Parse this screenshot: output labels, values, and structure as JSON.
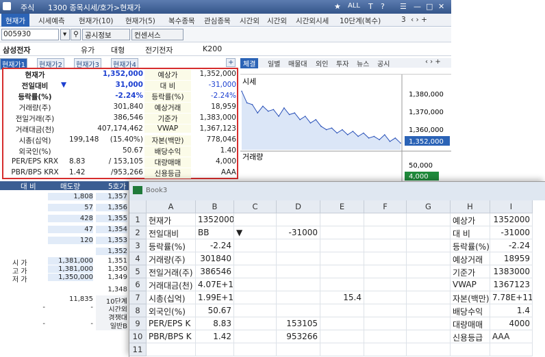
{
  "window": {
    "menu_label": "주식",
    "title": "1300 종목시세/호가>현재가"
  },
  "title_buttons": [
    "★",
    "ALL",
    "T",
    "?",
    "☰",
    "—",
    "□",
    "✕"
  ],
  "menu_tabs": [
    "현재가",
    "시세예측",
    "현재가(10)",
    "현재가(5)",
    "복수종목",
    "관심종목",
    "시간외",
    "시간외",
    "시간외시세",
    "10단계(복수)",
    "3"
  ],
  "search": {
    "code": "005930",
    "btn_info": "공시정보",
    "btn_consensus": "컨센서스"
  },
  "stock": {
    "name": "삼성전자",
    "market": "유가",
    "size": "대형",
    "sector": "전기전자",
    "index": "K200"
  },
  "sub_tabs": [
    "현재가1",
    "현재가2",
    "현재가3",
    "현재가4"
  ],
  "quote_rows": [
    {
      "l1": "현재가",
      "v1": "1,352,000",
      "l2": "예상가",
      "v2": "1,352,000"
    },
    {
      "l1": "전일대비",
      "sym": "▼",
      "v1": "31,000",
      "l2": "대 비",
      "v2": "-31,000"
    },
    {
      "l1": "등락률(%)",
      "v1": "-2.24%",
      "l2": "등락률(%)",
      "v2": "-2.24%"
    },
    {
      "l1": "거래량(주)",
      "v1": "301,840",
      "l2": "예상거래",
      "v2": "18,959"
    },
    {
      "l1": "전일거래(주)",
      "v1": "386,546",
      "l2": "기준가",
      "v2": "1,383,000"
    },
    {
      "l1": "거래대금(천)",
      "v1": "407,174,462",
      "l2": "VWAP",
      "v2": "1,367,123"
    },
    {
      "l1": "시총(십억)",
      "v0": "199,148",
      "v1": "(15.40%)",
      "l2": "자본(백만)",
      "v2": "778,046"
    },
    {
      "l1": "외국인(%)",
      "v1": "50.67",
      "l2": "배당수익",
      "v2": "1.40"
    },
    {
      "l1": "PER/EPS KRX",
      "v0": "8.83",
      "v1": "/ 153,105",
      "l2": "대량매매",
      "v2": "4,000"
    },
    {
      "l1": "PBR/BPS KRX",
      "v0": "1.42",
      "v1": "/953,266",
      "l2": "신용등급",
      "v2": "AAA"
    }
  ],
  "right_tabs": [
    "체결",
    "일별",
    "매물대",
    "외인",
    "투자",
    "뉴스",
    "공시"
  ],
  "chart": {
    "label_price": "시세",
    "label_volume": "거래량",
    "price_ticks": [
      "1,380,000",
      "1,370,000",
      "1,360,000"
    ],
    "current": "1,352,000",
    "vol_tick": "50,000",
    "vol_current": "4,000"
  },
  "chart_data": {
    "type": "line",
    "series": [
      {
        "values": [
          1383000,
          1376000,
          1375000,
          1370000,
          1374000,
          1371000,
          1372000,
          1368000,
          1373000,
          1369000,
          1370000,
          1366000,
          1368000,
          1364000,
          1366000,
          1362000,
          1360000,
          1361000,
          1358000,
          1360000,
          1357000,
          1359000,
          1356000,
          1358000,
          1355000,
          1356000,
          1354000,
          1357000,
          1353000,
          1355000,
          1352000
        ]
      }
    ],
    "ylim": [
      1348000,
      1388000
    ]
  },
  "left_grid": {
    "headers": [
      "대 비",
      "매도량",
      "5호가"
    ],
    "sell": [
      [
        "",
        "1,808",
        "1,357"
      ],
      [
        "",
        "57",
        "1,356"
      ],
      [
        "",
        "428",
        "1,355"
      ],
      [
        "",
        "47",
        "1,354"
      ],
      [
        "",
        "120",
        "1,353"
      ]
    ],
    "ohl": [
      [
        "시 가",
        "1,381,000",
        "1,351"
      ],
      [
        "고 가",
        "1,381,000",
        "1,350"
      ],
      [
        "저 가",
        "1,350,000",
        "1,349"
      ]
    ],
    "mid": "1,352",
    "extra": [
      "1,348"
    ],
    "bottom": [
      [
        "",
        "11,835",
        "10단계"
      ],
      [
        "-",
        "-",
        "시간외"
      ],
      [
        "",
        "",
        "경쟁대"
      ],
      [
        "-",
        "-",
        "일반B"
      ]
    ]
  },
  "excel": {
    "title": "Book3",
    "cols": [
      "A",
      "B",
      "C",
      "D",
      "E",
      "F",
      "G",
      "H",
      "I"
    ],
    "rows": [
      [
        "현재가",
        "1352000",
        "",
        "",
        "",
        "",
        "",
        "예상가",
        "1352000"
      ],
      [
        "전일대비",
        "BB",
        "▼",
        "-31000",
        "",
        "",
        "",
        "대 비",
        "-31000"
      ],
      [
        "등락률(%)",
        "-2.24",
        "",
        "",
        "",
        "",
        "",
        "등락률(%)",
        "-2.24"
      ],
      [
        "거래량(주)",
        "301840",
        "",
        "",
        "",
        "",
        "",
        "예상거래",
        "18959"
      ],
      [
        "전일거래(주)",
        "386546",
        "",
        "",
        "",
        "",
        "",
        "기준가",
        "1383000"
      ],
      [
        "거래대금(천)",
        "4.07E+11",
        "",
        "",
        "",
        "",
        "",
        "VWAP",
        "1367123"
      ],
      [
        "시총(십억)",
        "1.99E+14",
        "",
        "",
        "15.4",
        "",
        "",
        "자본(백만)",
        "7.78E+11"
      ],
      [
        "외국인(%)",
        "50.67",
        "",
        "",
        "",
        "",
        "",
        "배당수익",
        "1.4"
      ],
      [
        "PER/EPS K",
        "8.83",
        "",
        "153105",
        "",
        "",
        "",
        "대량매매",
        "4000"
      ],
      [
        "PBR/BPS K",
        "1.42",
        "",
        "953266",
        "",
        "",
        "",
        "신용등급",
        "AAA"
      ]
    ],
    "row_nums": [
      "1",
      "2",
      "3",
      "4",
      "5",
      "6",
      "7",
      "8",
      "9",
      "10",
      "11"
    ]
  },
  "colors": {
    "title_bg": "#3d5c8c",
    "accent": "#2b63b6",
    "highlight": "#d62c2c",
    "chart_fill": "#dbe6f7",
    "chart_line": "#2850b8"
  }
}
